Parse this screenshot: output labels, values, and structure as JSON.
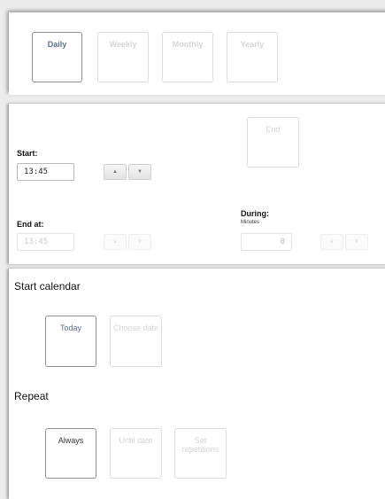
{
  "frequency": {
    "tabs": [
      {
        "label": "Daily"
      },
      {
        "label": "Weekly"
      },
      {
        "label": "Monthly"
      },
      {
        "label": "Yearly"
      }
    ],
    "selected": "Daily"
  },
  "schedule": {
    "end_label": "End",
    "start": {
      "label": "Start:",
      "value": "13:45"
    },
    "end_at": {
      "label": "End at:",
      "value": "13:45"
    },
    "during": {
      "label": "During:",
      "unit": "Minutes",
      "value": "0"
    },
    "spin_up": "▲",
    "spin_down": "▼"
  },
  "start_calendar": {
    "heading": "Start calendar",
    "options": [
      {
        "label": "Today"
      },
      {
        "label": "Choose date"
      }
    ],
    "selected": "Today"
  },
  "repeat": {
    "heading": "Repeat",
    "options": [
      {
        "label": "Always"
      },
      {
        "label": "Until date"
      },
      {
        "label": "Set repetitions"
      }
    ],
    "selected": "Always"
  }
}
